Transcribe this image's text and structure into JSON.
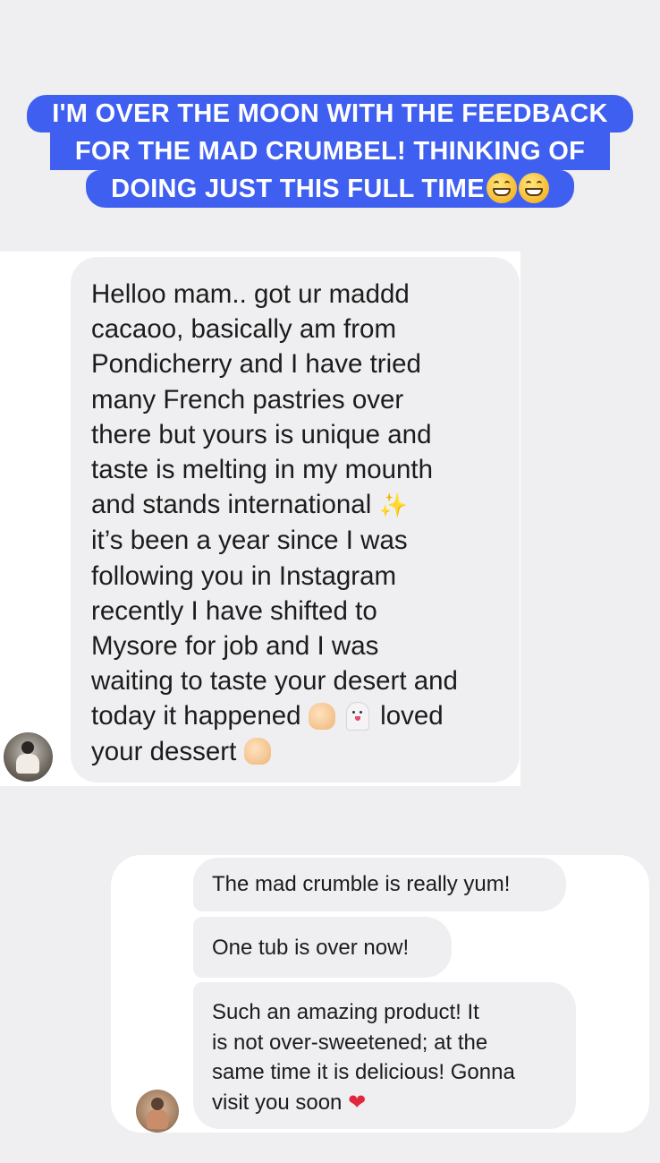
{
  "banner": {
    "line1": "I'M OVER THE MOON WITH THE FEEDBACK",
    "line2": "FOR THE MAD CRUMBEL! THINKING OF",
    "line3": "DOING JUST THIS FULL TIME",
    "emoji": "grinning-face-with-smiling-eyes"
  },
  "message1": {
    "lines": [
      "Helloo mam.. got ur maddd",
      "cacaoo, basically am from",
      "Pondicherry and I have tried",
      "many French pastries over",
      "there but yours is unique and",
      "taste is melting in my mounth",
      "and stands international",
      "it’s been a year since I was",
      "following you in Instagram",
      "recently I have shifted to",
      "Mysore for job and I was",
      "waiting to taste your desert and",
      "today it happened",
      "loved",
      "your dessert"
    ],
    "emojis": [
      "sparkles",
      "pinched-fingers",
      "ghost",
      "raising-hands"
    ]
  },
  "message2": {
    "bubble1": "The mad crumble is really yum!",
    "bubble2": "One tub is over now!",
    "bubble3_lines": [
      "Such an amazing product! It",
      "is not over-sweetened; at the",
      "same time it is delicious! Gonna",
      "visit you soon"
    ],
    "emoji": "red-heart"
  },
  "colors": {
    "background": "#efeff1",
    "banner": "#3f5ff0",
    "panel": "#ffffff",
    "bubble": "#efeff1",
    "text": "#1c1c1c",
    "heart": "#e3263b"
  }
}
